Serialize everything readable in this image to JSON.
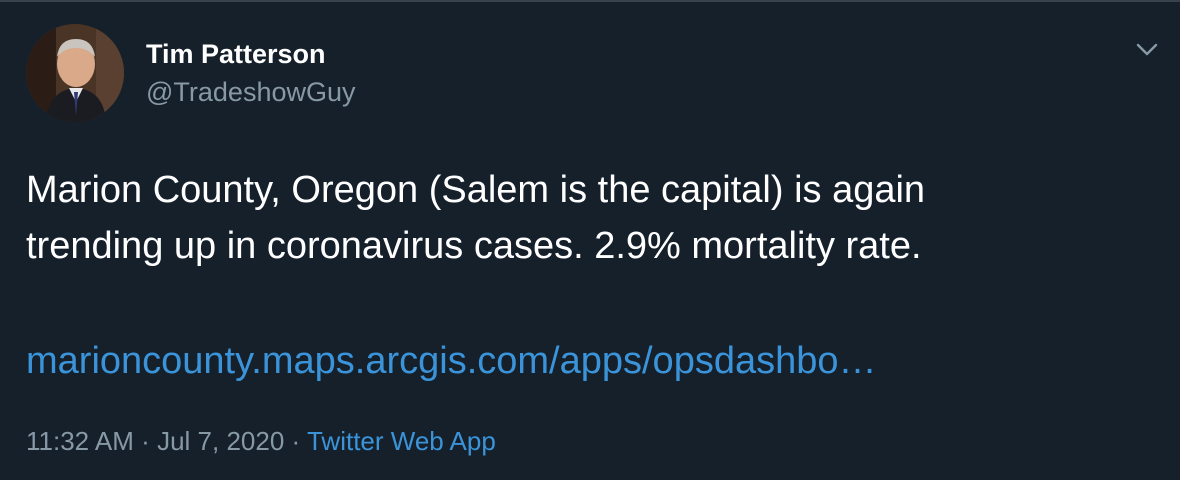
{
  "author": {
    "name": "Tim Patterson",
    "handle": "@TradeshowGuy"
  },
  "tweet": {
    "line1": "Marion County, Oregon (Salem is the capital) is again",
    "line2": "trending up in coronavirus cases. 2.9% mortality rate.",
    "link_text": "marioncounty.maps.arcgis.com/apps/opsdashbo…"
  },
  "meta": {
    "time": "11:32 AM",
    "date": "Jul 7, 2020",
    "separator": "·",
    "source": "Twitter Web App"
  },
  "icons": {
    "caret": "chevron-down-icon"
  },
  "colors": {
    "background": "#15202b",
    "text": "#ffffff",
    "secondary": "#8899a6",
    "link": "#3b94d9"
  }
}
